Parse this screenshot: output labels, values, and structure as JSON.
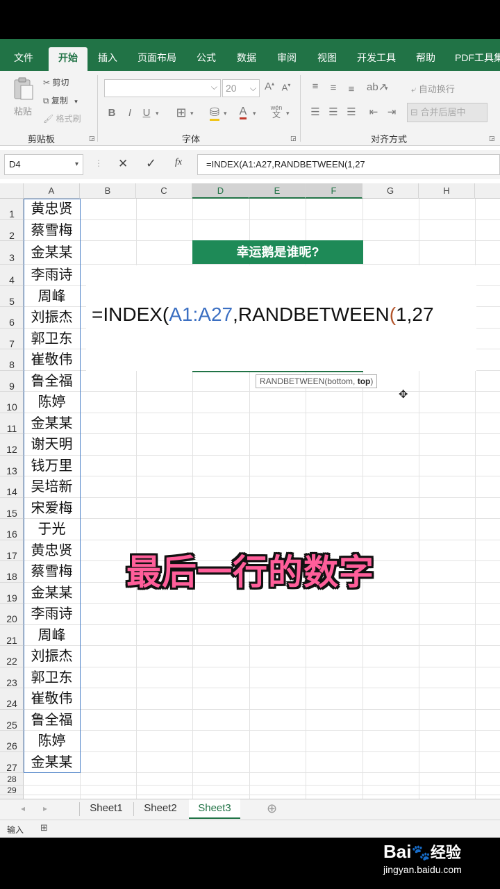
{
  "ribbon_tabs": [
    "文件",
    "开始",
    "插入",
    "页面布局",
    "公式",
    "数据",
    "审阅",
    "视图",
    "开发工具",
    "帮助",
    "PDF工具集"
  ],
  "ribbon": {
    "clipboard": {
      "paste": "粘贴",
      "cut": "剪切",
      "copy": "复制",
      "format_painter": "格式刷",
      "group": "剪贴板"
    },
    "font": {
      "size": "20",
      "bold": "B",
      "italic": "I",
      "underline": "U",
      "group": "字体",
      "grow": "A",
      "shrink": "A",
      "color": "A",
      "phonetic_top": "wén",
      "phonetic_bottom": "文"
    },
    "alignment": {
      "wrap": "自动换行",
      "merge": "合并后居中",
      "group": "对齐方式"
    }
  },
  "formula_bar": {
    "name_box": "D4",
    "cancel": "✕",
    "enter": "✓",
    "fx": "fx",
    "formula": "=INDEX(A1:A27,RANDBETWEEN(1,27"
  },
  "columns": [
    "A",
    "B",
    "C",
    "D",
    "E",
    "F",
    "G",
    "H"
  ],
  "rows": [
    "1",
    "2",
    "3",
    "4",
    "5",
    "6",
    "7",
    "8",
    "9",
    "10",
    "11",
    "12",
    "13",
    "14",
    "15",
    "16",
    "17",
    "18",
    "19",
    "20",
    "21",
    "22",
    "23",
    "24",
    "25",
    "26",
    "27",
    "28",
    "29"
  ],
  "names": [
    "黄忠贤",
    "蔡雪梅",
    "金某某",
    "李雨诗",
    "周峰",
    "刘振杰",
    "郭卫东",
    "崔敬伟",
    "鲁全福",
    "陈婷",
    "金某某",
    "谢天明",
    "钱万里",
    "吴培新",
    "宋爱梅",
    "于光",
    "黄忠贤",
    "蔡雪梅",
    "金某某",
    "李雨诗",
    "周峰",
    "刘振杰",
    "郭卫东",
    "崔敬伟",
    "鲁全福",
    "陈婷",
    "金某某"
  ],
  "banner": "幸运鹅是谁呢?",
  "edit": {
    "prefix": "=INDEX(",
    "ref": "A1:A27",
    "mid": ",RANDBETWEEN",
    "paren": "(",
    "tail": "1,27"
  },
  "tooltip": {
    "func": "RANDBETWEEN(bottom, ",
    "arg": "top",
    "close": ")"
  },
  "caption": "最后一行的数字",
  "sheets": [
    "Sheet1",
    "Sheet2",
    "Sheet3"
  ],
  "status": {
    "mode": "输入"
  },
  "watermark": {
    "brand": "Bai",
    "brand2": "经验",
    "url": "jingyan.baidu.com"
  }
}
